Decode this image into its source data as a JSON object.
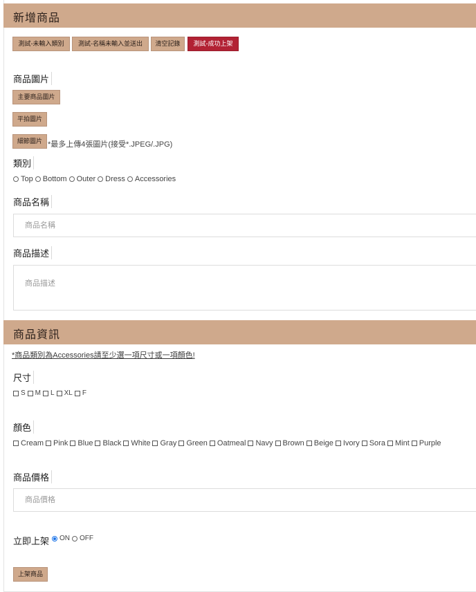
{
  "header": {
    "title": "新增商品"
  },
  "test_buttons": [
    {
      "label": "測試-未輸入類別"
    },
    {
      "label": "測試-名稱未輸入並送出"
    },
    {
      "label": "清空記錄"
    },
    {
      "label": "測試-成功上架"
    }
  ],
  "images": {
    "label": "商品圖片",
    "main_button": "主要商品圖片",
    "flat_button": "平拍圖片",
    "detail_button": "細節圖片",
    "hint": "*最多上傳4張圖片(接受*.JPEG/.JPG)"
  },
  "category": {
    "label": "類別",
    "options": [
      "Top",
      "Bottom",
      "Outer",
      "Dress",
      "Accessories"
    ]
  },
  "name": {
    "label": "商品名稱",
    "placeholder": "商品名稱"
  },
  "description": {
    "label": "商品描述",
    "placeholder": "商品描述"
  },
  "info": {
    "title": "商品資訊",
    "note": "*商品類別為Accessories請至少選一項尺寸或一項顏色!"
  },
  "size": {
    "label": "尺寸",
    "options": [
      "S",
      "M",
      "L",
      "XL",
      "F"
    ]
  },
  "color": {
    "label": "顏色",
    "options": [
      "Cream",
      "Pink",
      "Blue",
      "Black",
      "White",
      "Gray",
      "Green",
      "Oatmeal",
      "Navy",
      "Brown",
      "Beige",
      "Ivory",
      "Sora",
      "Mint",
      "Purple"
    ]
  },
  "price": {
    "label": "商品價格",
    "placeholder": "商品價格"
  },
  "publish": {
    "label": "立即上架",
    "options": [
      {
        "label": "ON",
        "checked": true
      },
      {
        "label": "OFF",
        "checked": false
      }
    ]
  },
  "submit": {
    "label": "上架商品"
  },
  "colors": {
    "accent": "#cfa98c",
    "danger": "#b22234",
    "radio_checked": "#1a73e8"
  }
}
